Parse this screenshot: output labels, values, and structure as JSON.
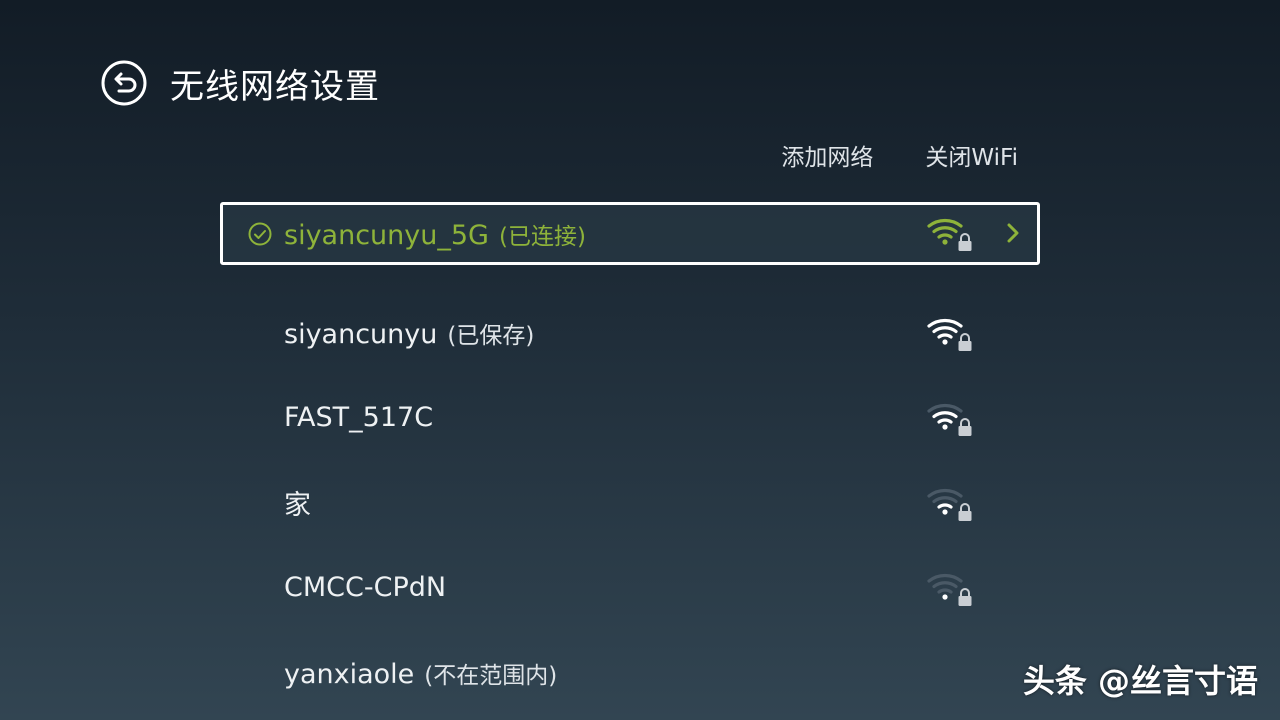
{
  "header": {
    "title": "无线网络设置",
    "back_icon": "back-arrow-circle-icon"
  },
  "actions": {
    "add_network": "添加网络",
    "turn_off_wifi": "关闭WiFi"
  },
  "colors": {
    "accent": "#8eb33a",
    "text": "#eef1f3",
    "signal_dim": "#4a5966"
  },
  "networks": [
    {
      "ssid": "siyancunyu_5G",
      "status": "(已连接)",
      "signal": 4,
      "locked": true,
      "connected": true
    },
    {
      "ssid": "siyancunyu",
      "status": "(已保存)",
      "signal": 4,
      "locked": true,
      "connected": false
    },
    {
      "ssid": "FAST_517C",
      "status": "",
      "signal": 3,
      "locked": true,
      "connected": false
    },
    {
      "ssid": "家",
      "status": "",
      "signal": 2,
      "locked": true,
      "connected": false
    },
    {
      "ssid": "CMCC-CPdN",
      "status": "",
      "signal": 1,
      "locked": true,
      "connected": false
    },
    {
      "ssid": "yanxiaole",
      "status": "(不在范围内)",
      "signal": 0,
      "locked": false,
      "connected": false
    }
  ],
  "watermark": "头条 @丝言寸语"
}
